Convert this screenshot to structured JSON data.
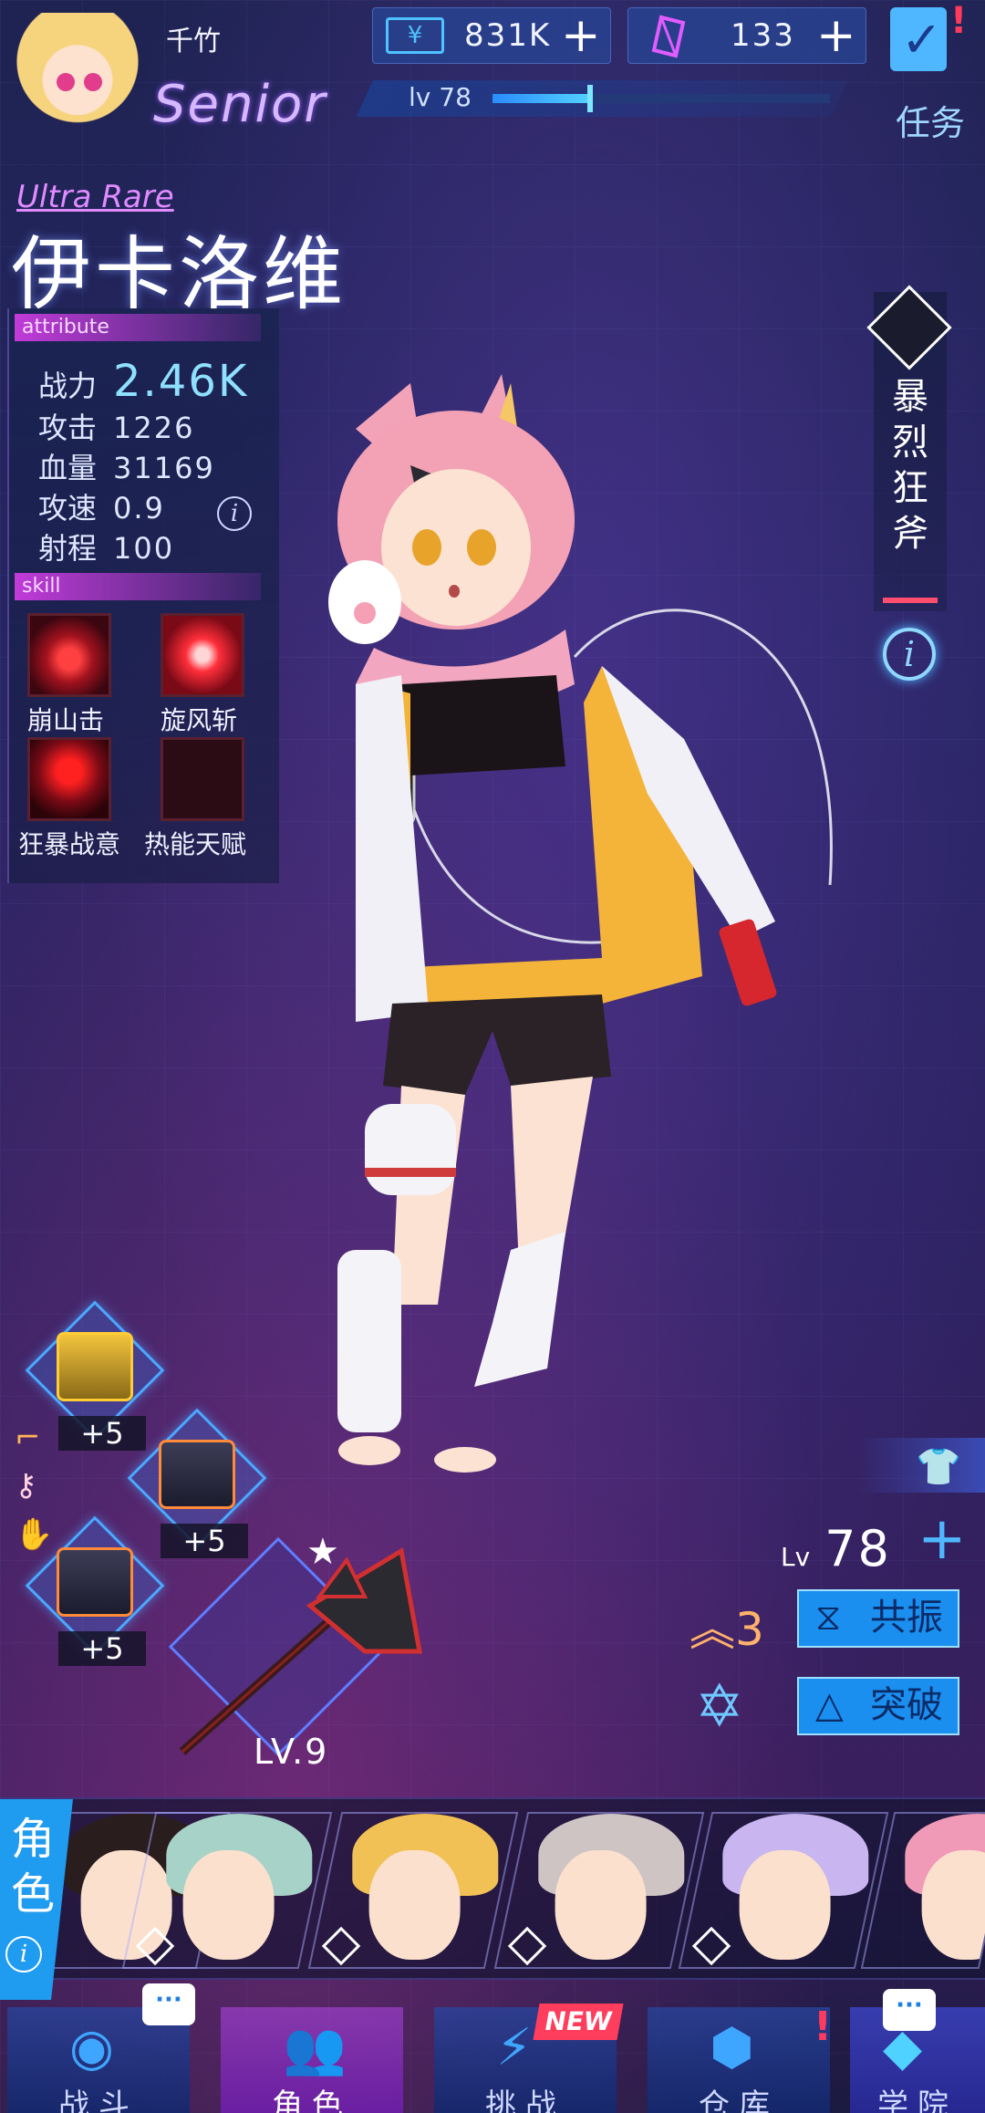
{
  "header": {
    "player_name": "千竹",
    "rank": "Senior",
    "level_label": "lv 78",
    "level_progress": 0.29,
    "gold": "831K",
    "gems": "133",
    "plus_symbol": "+",
    "task_label": "任务",
    "task_alert": "!"
  },
  "character": {
    "rarity": "Ultra Rare",
    "name": "伊卡洛维"
  },
  "attributes": {
    "section_label": "attribute",
    "power_label": "战力",
    "power_value": "2.46K",
    "rows": [
      {
        "label": "攻击",
        "value": "1226"
      },
      {
        "label": "血量",
        "value": "31169"
      },
      {
        "label": "攻速",
        "value": "0.9"
      },
      {
        "label": "射程",
        "value": "100"
      }
    ]
  },
  "skills": {
    "section_label": "skill",
    "items": [
      {
        "label": "崩山击"
      },
      {
        "label": "旋风斩"
      },
      {
        "label": "狂暴战意"
      },
      {
        "label": "热能天赋"
      }
    ]
  },
  "weapon_skill": {
    "label": "暴烈狂斧"
  },
  "equipment": {
    "gear": [
      {
        "level": "+5",
        "icon": "armor-icon"
      },
      {
        "level": "+5",
        "icon": "armor-icon"
      },
      {
        "level": "+5",
        "icon": "armor-icon"
      }
    ],
    "weapon_level": "LV.9"
  },
  "actions": {
    "lv_prefix": "Lv",
    "char_level": "78",
    "star_count": "3",
    "resonance_label": "共振",
    "breakthrough_label": "突破"
  },
  "roster": {
    "tab_label": "角色",
    "portraits": [
      {
        "hair": "#2a1d1d"
      },
      {
        "hair": "#a7d2c8"
      },
      {
        "hair": "#f2c155"
      },
      {
        "hair": "#cfc4c4"
      },
      {
        "hair": "#c9b5f0"
      },
      {
        "hair": "#f09ab8"
      }
    ]
  },
  "nav": {
    "items": [
      {
        "label": "战斗"
      },
      {
        "label": "角色"
      },
      {
        "label": "挑战"
      },
      {
        "label": "仓库"
      },
      {
        "label": "学院"
      }
    ],
    "new_badge": "NEW",
    "alert": "!",
    "bubble": "···"
  },
  "colors": {
    "accent_blue": "#1a8ff0",
    "accent_purple": "#c13bd9",
    "alert_red": "#ff3a5c"
  }
}
